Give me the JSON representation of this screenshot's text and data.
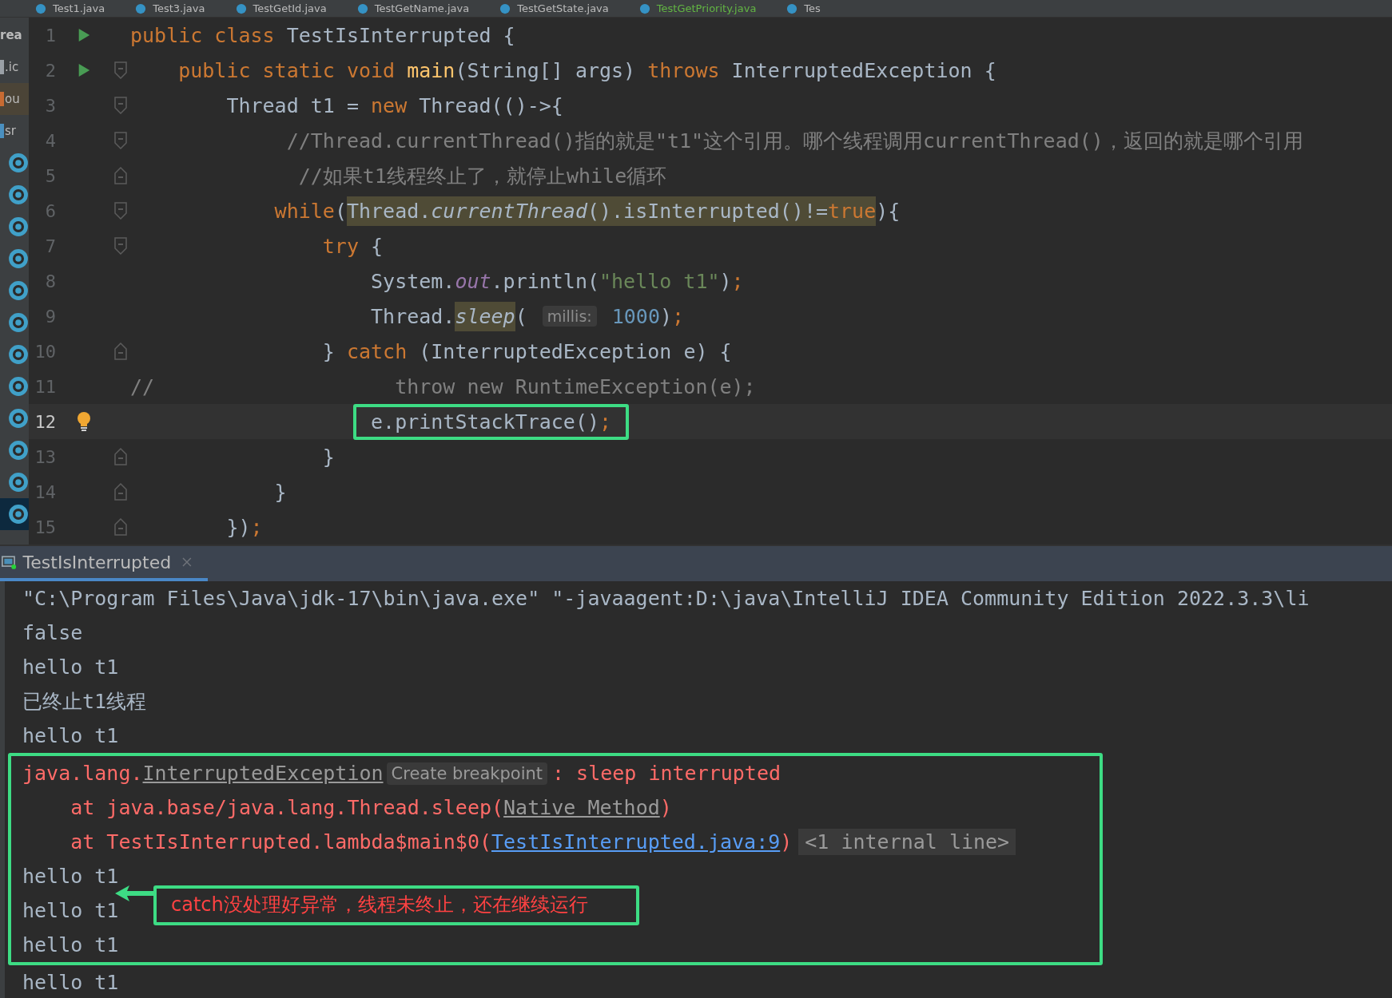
{
  "editor_tabs": [
    {
      "label": "Test1.java",
      "color": "#bbbbbb"
    },
    {
      "label": "Test3.java",
      "color": "#bbbbbb"
    },
    {
      "label": "TestGetId.java",
      "color": "#bbbbbb"
    },
    {
      "label": "TestGetName.java",
      "color": "#bbbbbb"
    },
    {
      "label": "TestGetState.java",
      "color": "#bbbbbb"
    },
    {
      "label": "TestGetPriority.java",
      "color": "#62b543"
    },
    {
      "label": "Tes",
      "color": "#bbbbbb"
    }
  ],
  "project_tree": [
    {
      "kind": "root",
      "label": "rea",
      "selected": false
    },
    {
      "kind": "module",
      "label": ".ic",
      "selected": false
    },
    {
      "kind": "output",
      "label": "ou",
      "selected": false
    },
    {
      "kind": "source",
      "label": "sr",
      "selected": false
    },
    {
      "kind": "class",
      "selected": false
    },
    {
      "kind": "class",
      "selected": false
    },
    {
      "kind": "class",
      "selected": false
    },
    {
      "kind": "class",
      "selected": false
    },
    {
      "kind": "class",
      "selected": false
    },
    {
      "kind": "class",
      "selected": false
    },
    {
      "kind": "class",
      "selected": false
    },
    {
      "kind": "class",
      "selected": false
    },
    {
      "kind": "class",
      "selected": false
    },
    {
      "kind": "class",
      "selected": false
    },
    {
      "kind": "class",
      "selected": false
    },
    {
      "kind": "class",
      "selected": true
    }
  ],
  "code_lines": [
    {
      "number": "1",
      "runnable": true,
      "bulb": false,
      "fold_start": false,
      "fold_end": false,
      "current": false,
      "outlined": false,
      "tokens": [
        {
          "text": "public class ",
          "kind": "keyword"
        },
        {
          "text": "TestIsInterrupted {",
          "kind": "plain"
        }
      ]
    },
    {
      "number": "2",
      "runnable": true,
      "bulb": false,
      "fold_start": true,
      "fold_end": false,
      "current": false,
      "outlined": false,
      "tokens": [
        {
          "text": "    public static void ",
          "kind": "keyword"
        },
        {
          "text": "main",
          "kind": "method"
        },
        {
          "text": "(String[] args) ",
          "kind": "plain"
        },
        {
          "text": "throws ",
          "kind": "keyword"
        },
        {
          "text": "InterruptedException {",
          "kind": "plain"
        }
      ]
    },
    {
      "number": "3",
      "runnable": false,
      "bulb": false,
      "fold_start": true,
      "fold_end": false,
      "current": false,
      "outlined": false,
      "tokens": [
        {
          "text": "        Thread t1 = ",
          "kind": "plain"
        },
        {
          "text": "new ",
          "kind": "keyword"
        },
        {
          "text": "Thread(()->{",
          "kind": "plain"
        }
      ]
    },
    {
      "number": "4",
      "runnable": false,
      "bulb": false,
      "fold_start": true,
      "fold_end": false,
      "current": false,
      "outlined": false,
      "tokens": [
        {
          "text": "             //Thread.currentThread()指的就是\"t1\"这个引用。哪个线程调用currentThread()，返回的就是哪个引用",
          "kind": "comment"
        }
      ]
    },
    {
      "number": "5",
      "runnable": false,
      "bulb": false,
      "fold_start": false,
      "fold_end": true,
      "current": false,
      "outlined": false,
      "tokens": [
        {
          "text": "              //如果t1线程终止了，就停止while循环",
          "kind": "comment"
        }
      ]
    },
    {
      "number": "6",
      "runnable": false,
      "bulb": false,
      "fold_start": true,
      "fold_end": false,
      "current": false,
      "outlined": false,
      "tokens": [
        {
          "text": "            while",
          "kind": "keyword"
        },
        {
          "text": "(",
          "kind": "plain"
        },
        {
          "kind": "usage",
          "tokens": [
            {
              "text": "Thread.",
              "kind": "plain"
            },
            {
              "text": "currentThread",
              "kind": "italic"
            },
            {
              "text": "().isInterrupted()!=",
              "kind": "plain"
            },
            {
              "text": "true",
              "kind": "keyword"
            }
          ]
        },
        {
          "text": "){",
          "kind": "plain"
        }
      ]
    },
    {
      "number": "7",
      "runnable": false,
      "bulb": false,
      "fold_start": true,
      "fold_end": false,
      "current": false,
      "outlined": false,
      "tokens": [
        {
          "text": "                try ",
          "kind": "keyword"
        },
        {
          "text": "{",
          "kind": "plain"
        }
      ]
    },
    {
      "number": "8",
      "runnable": false,
      "bulb": false,
      "fold_start": false,
      "fold_end": false,
      "current": false,
      "outlined": false,
      "tokens": [
        {
          "text": "                    System.",
          "kind": "plain"
        },
        {
          "text": "out",
          "kind": "static"
        },
        {
          "text": ".println(",
          "kind": "plain"
        },
        {
          "text": "\"hello t1\"",
          "kind": "string"
        },
        {
          "text": ")",
          "kind": "plain"
        },
        {
          "text": ";",
          "kind": "keyword"
        }
      ]
    },
    {
      "number": "9",
      "runnable": false,
      "bulb": false,
      "fold_start": false,
      "fold_end": false,
      "current": false,
      "outlined": false,
      "tokens": [
        {
          "text": "                    Thread.",
          "kind": "plain"
        },
        {
          "kind": "usage",
          "tokens": [
            {
              "text": "sleep",
              "kind": "italic"
            }
          ]
        },
        {
          "text": "( ",
          "kind": "plain"
        },
        {
          "text": "millis:",
          "kind": "hint"
        },
        {
          "text": " 1000",
          "kind": "number"
        },
        {
          "text": ")",
          "kind": "plain"
        },
        {
          "text": ";",
          "kind": "keyword"
        }
      ]
    },
    {
      "number": "10",
      "runnable": false,
      "bulb": false,
      "fold_start": false,
      "fold_end": true,
      "current": false,
      "outlined": false,
      "tokens": [
        {
          "text": "                } ",
          "kind": "plain"
        },
        {
          "text": "catch ",
          "kind": "keyword"
        },
        {
          "text": "(InterruptedException e) {",
          "kind": "plain"
        }
      ]
    },
    {
      "number": "11",
      "runnable": false,
      "bulb": false,
      "fold_start": false,
      "fold_end": false,
      "current": false,
      "outlined": false,
      "tokens": [
        {
          "text": "//                    throw new RuntimeException(e);",
          "kind": "comment"
        }
      ]
    },
    {
      "number": "12",
      "runnable": false,
      "bulb": true,
      "fold_start": false,
      "fold_end": false,
      "current": true,
      "outlined": true,
      "tokens": [
        {
          "text": "                    e.printStackTrace()",
          "kind": "plain"
        },
        {
          "text": ";",
          "kind": "keyword"
        }
      ]
    },
    {
      "number": "13",
      "runnable": false,
      "bulb": false,
      "fold_start": false,
      "fold_end": true,
      "current": false,
      "outlined": false,
      "tokens": [
        {
          "text": "                }",
          "kind": "plain"
        }
      ]
    },
    {
      "number": "14",
      "runnable": false,
      "bulb": false,
      "fold_start": false,
      "fold_end": true,
      "current": false,
      "outlined": false,
      "tokens": [
        {
          "text": "            }",
          "kind": "plain"
        }
      ]
    },
    {
      "number": "15",
      "runnable": false,
      "bulb": false,
      "fold_start": false,
      "fold_end": true,
      "current": false,
      "outlined": false,
      "tokens": [
        {
          "text": "        })",
          "kind": "plain"
        },
        {
          "text": ";",
          "kind": "keyword"
        }
      ]
    }
  ],
  "run_panel": {
    "tab": {
      "label": "TestIsInterrupted",
      "selected": true
    },
    "callout": {
      "text": "catch没处理好异常，线程未终止，还在继续运行"
    },
    "lines": [
      {
        "outlined": false,
        "tokens": [
          {
            "text": "\"C:\\Program Files\\Java\\jdk-17\\bin\\java.exe\" \"-javaagent:D:\\java\\IntelliJ IDEA Community Edition 2022.3.3\\li",
            "kind": "plain"
          }
        ]
      },
      {
        "outlined": false,
        "tokens": [
          {
            "text": "false",
            "kind": "plain"
          }
        ]
      },
      {
        "outlined": false,
        "tokens": [
          {
            "text": "hello t1",
            "kind": "plain"
          }
        ]
      },
      {
        "outlined": false,
        "tokens": [
          {
            "text": "已终止t1线程",
            "kind": "plain"
          }
        ]
      },
      {
        "outlined": false,
        "tokens": [
          {
            "text": "hello t1",
            "kind": "plain"
          }
        ]
      },
      {
        "outlined": true,
        "tokens": [
          {
            "text": "java.lang.",
            "kind": "error"
          },
          {
            "text": "InterruptedException",
            "kind": "reference"
          },
          {
            "text": "Create breakpoint",
            "kind": "hint"
          },
          {
            "text": ": sleep interrupted",
            "kind": "error"
          }
        ]
      },
      {
        "outlined": true,
        "tokens": [
          {
            "text": "    at java.base/java.lang.Thread.sleep(",
            "kind": "error"
          },
          {
            "text": "Native Method",
            "kind": "reference"
          },
          {
            "text": ")",
            "kind": "error"
          }
        ]
      },
      {
        "outlined": true,
        "tokens": [
          {
            "text": "    at TestIsInterrupted.lambda$main$0(",
            "kind": "error"
          },
          {
            "text": "TestIsInterrupted.java:9",
            "kind": "link"
          },
          {
            "text": ")",
            "kind": "error"
          },
          {
            "text": "<1 internal line>",
            "kind": "folded"
          }
        ]
      },
      {
        "outlined": true,
        "tokens": [
          {
            "text": "hello t1",
            "kind": "plain"
          }
        ]
      },
      {
        "outlined": true,
        "tokens": [
          {
            "text": "hello t1",
            "kind": "plain"
          }
        ]
      },
      {
        "outlined": true,
        "tokens": [
          {
            "text": "hello t1",
            "kind": "plain"
          }
        ]
      },
      {
        "outlined": false,
        "tokens": [
          {
            "text": "hello t1",
            "kind": "plain"
          }
        ]
      }
    ]
  }
}
